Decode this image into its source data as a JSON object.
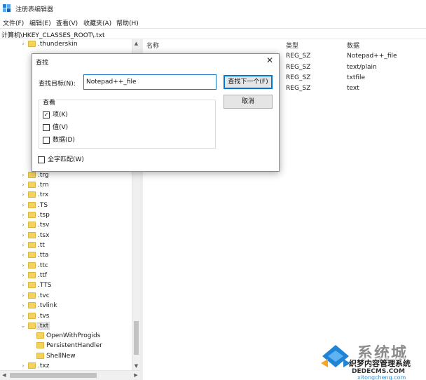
{
  "window": {
    "title": "注册表编辑器"
  },
  "menu": [
    "文件(F)",
    "编辑(E)",
    "查看(V)",
    "收藏夹(A)",
    "帮助(H)"
  ],
  "address": "计算机\\HKEY_CLASSES_ROOT\\.txt",
  "tree": {
    "items": [
      {
        "label": ".thunderskin",
        "expandable": true
      },
      {
        "label": ".trg",
        "expandable": true
      },
      {
        "label": ".trn",
        "expandable": true
      },
      {
        "label": ".trx",
        "expandable": true
      },
      {
        "label": ".TS",
        "expandable": true
      },
      {
        "label": ".tsp",
        "expandable": true
      },
      {
        "label": ".tsv",
        "expandable": true
      },
      {
        "label": ".tsx",
        "expandable": true
      },
      {
        "label": ".tt",
        "expandable": true
      },
      {
        "label": ".tta",
        "expandable": true
      },
      {
        "label": ".ttc",
        "expandable": true
      },
      {
        "label": ".ttf",
        "expandable": true
      },
      {
        "label": ".TTS",
        "expandable": true
      },
      {
        "label": ".tvc",
        "expandable": true
      },
      {
        "label": ".tvlink",
        "expandable": true
      },
      {
        "label": ".tvs",
        "expandable": true
      },
      {
        "label": ".txt",
        "expandable": true,
        "expanded": true,
        "selected": true
      },
      {
        "label": "OpenWithProgids",
        "expandable": false,
        "child": true
      },
      {
        "label": "PersistentHandler",
        "expandable": false,
        "child": true
      },
      {
        "label": "ShellNew",
        "expandable": false,
        "child": true
      },
      {
        "label": ".txz",
        "expandable": true
      }
    ]
  },
  "list": {
    "headers": {
      "name": "名称",
      "type": "类型",
      "data": "数据"
    },
    "rows": [
      {
        "type": "REG_SZ",
        "data": "Notepad++_file"
      },
      {
        "type": "REG_SZ",
        "data": "text/plain"
      },
      {
        "type": "REG_SZ",
        "data": "txtfile"
      },
      {
        "type": "REG_SZ",
        "data": "text"
      }
    ]
  },
  "dialog": {
    "title": "查找",
    "find_label": "查找目标(N):",
    "find_value": "Notepad++_file",
    "find_next_label": "查找下一个(F)",
    "cancel_label": "取消",
    "look_at_title": "查看",
    "options": [
      {
        "label": "项(K)",
        "checked": true
      },
      {
        "label": "值(V)",
        "checked": false
      },
      {
        "label": "数据(D)",
        "checked": false
      }
    ],
    "match_whole": {
      "label": "全字匹配(W)",
      "checked": false
    }
  },
  "watermark": {
    "big_text": "系统城",
    "mid_text": "织梦内容管理系统",
    "small_text": "DEDECMS.COM",
    "url_text": "xitongcheng.com"
  },
  "colors": {
    "accent": "#0078d7",
    "folder": "#f2d35e",
    "watermark_blue": "#2f8ed8"
  }
}
